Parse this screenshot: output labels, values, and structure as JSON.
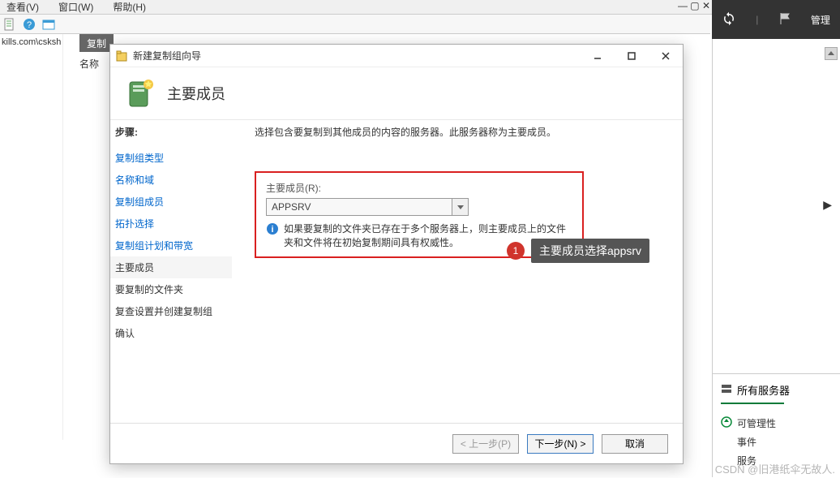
{
  "menubar": {
    "items": [
      "查看(V)",
      "窗口(W)",
      "帮助(H)"
    ]
  },
  "darkpanel": {
    "label": "管理"
  },
  "lefttree": {
    "domain": "kills.com\\csksh"
  },
  "greytab": {
    "label": "复制"
  },
  "namelabel": "名称",
  "wizard": {
    "title": "新建复制组向导",
    "heading": "主要成员",
    "steps_label": "步骤:",
    "steps": [
      {
        "label": "复制组类型",
        "type": "link"
      },
      {
        "label": "名称和域",
        "type": "link"
      },
      {
        "label": "复制组成员",
        "type": "link"
      },
      {
        "label": "拓扑选择",
        "type": "link"
      },
      {
        "label": "复制组计划和带宽",
        "type": "link"
      },
      {
        "label": "主要成员",
        "type": "current"
      },
      {
        "label": "要复制的文件夹",
        "type": "plain"
      },
      {
        "label": "复查设置并创建复制组",
        "type": "plain"
      },
      {
        "label": "确认",
        "type": "plain"
      }
    ],
    "instruction": "选择包含要复制到其他成员的内容的服务器。此服务器称为主要成员。",
    "field_label": "主要成员(R):",
    "field_value": "APPSRV",
    "info_text": "如果要复制的文件夹已存在于多个服务器上，则主要成员上的文件夹和文件将在初始复制期间具有权威性。",
    "buttons": {
      "prev": "< 上一步(P)",
      "next": "下一步(N) >",
      "cancel": "取消"
    }
  },
  "callout": {
    "num": "1",
    "text": "主要成员选择appsrv"
  },
  "rightpanel": {
    "all_servers": "所有服务器",
    "manageability": "可管理性",
    "events": "事件",
    "service": "服务"
  },
  "watermark": "CSDN @旧港纸伞无故人."
}
